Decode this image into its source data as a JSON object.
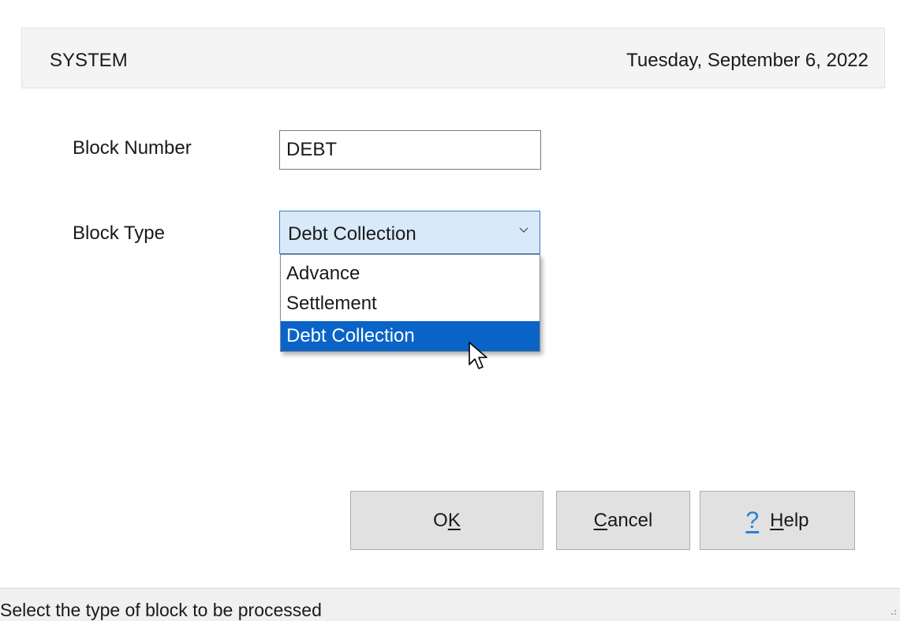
{
  "header": {
    "user": "SYSTEM",
    "date": "Tuesday, September 6, 2022"
  },
  "form": {
    "block_number_label": "Block Number",
    "block_number_value": "DEBT",
    "block_type_label": "Block Type",
    "block_type_selected": "Debt Collection",
    "block_type_options": [
      "Advance",
      "Settlement",
      "Debt Collection"
    ],
    "highlighted_option": "Debt Collection"
  },
  "buttons": {
    "ok": {
      "prefix": "O",
      "mnemonic": "K",
      "suffix": ""
    },
    "cancel": {
      "prefix": "",
      "mnemonic": "C",
      "suffix": "ancel"
    },
    "help": {
      "icon": "?",
      "prefix": "",
      "mnemonic": "H",
      "suffix": "elp"
    }
  },
  "status": {
    "text": "Select the type of block to be processed"
  },
  "colors": {
    "selection": "#0a64c8",
    "combo_focus": "#d8e9f9",
    "help_icon": "#2a7fd4"
  },
  "icons": {
    "dropdown": "chevron-down-icon",
    "help": "help-question-icon",
    "cursor": "mouse-pointer-icon"
  }
}
